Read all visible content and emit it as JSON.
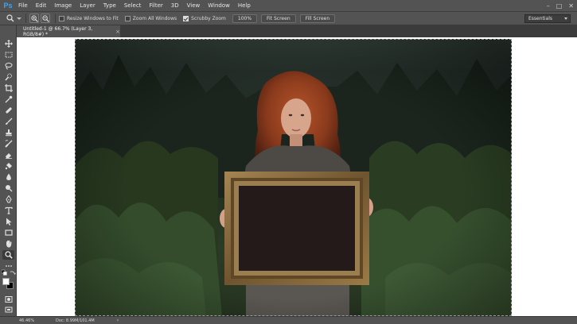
{
  "app": {
    "logo": "Ps",
    "menu": [
      "File",
      "Edit",
      "Image",
      "Layer",
      "Type",
      "Select",
      "Filter",
      "3D",
      "View",
      "Window",
      "Help"
    ],
    "window_controls": {
      "minimize": "–",
      "maximize": "□",
      "close": "✕"
    }
  },
  "options": {
    "resize_windows_to_fit": {
      "label": "Resize Windows to Fit",
      "checked": false
    },
    "zoom_all_windows": {
      "label": "Zoom All Windows",
      "checked": false
    },
    "scrubby_zoom": {
      "label": "Scrubby Zoom",
      "checked": true
    },
    "btn_100": "100%",
    "btn_fit_screen": "Fit Screen",
    "btn_fill_screen": "Fill Screen",
    "workspace": "Essentials"
  },
  "document": {
    "tab_title": "Untitled-1 @ 66.7% (Layer 3, RGB/8#) *",
    "close_glyph": "×"
  },
  "status": {
    "zoom": "46.46%",
    "doc_info": "Doc: 8.99M/101.4M",
    "arrow": "›"
  },
  "colors": {
    "foreground": "#ffffff",
    "background": "#000000",
    "accent": "#31a8ff"
  }
}
